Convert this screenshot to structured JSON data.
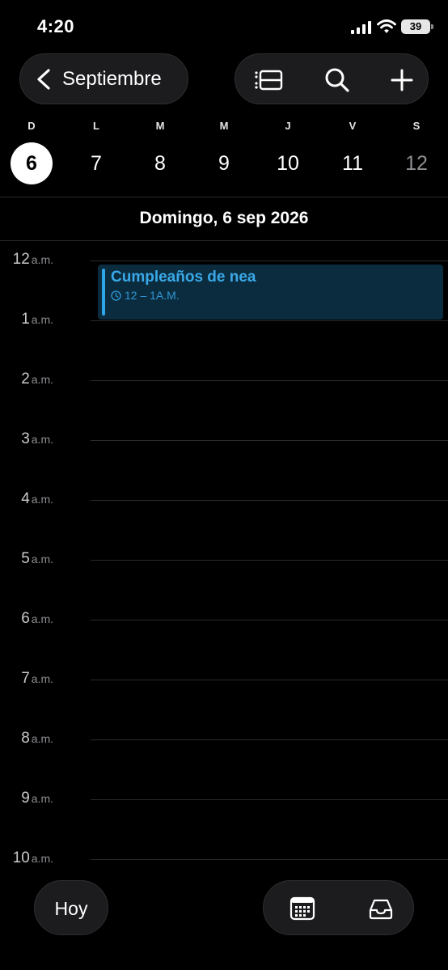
{
  "status_bar": {
    "time": "4:20",
    "battery": "39"
  },
  "nav": {
    "back_label": "Septiembre",
    "icons": [
      "list-view-icon",
      "search-icon",
      "plus-icon"
    ]
  },
  "week": {
    "days": [
      {
        "letter": "D",
        "num": "6",
        "selected": true
      },
      {
        "letter": "L",
        "num": "7"
      },
      {
        "letter": "M",
        "num": "8"
      },
      {
        "letter": "M",
        "num": "9"
      },
      {
        "letter": "J",
        "num": "10"
      },
      {
        "letter": "V",
        "num": "11"
      },
      {
        "letter": "S",
        "num": "12",
        "dim": true
      }
    ]
  },
  "date_title": "Domingo, 6 sep 2026",
  "hours": [
    {
      "num": "12",
      "ampm": "a.m."
    },
    {
      "num": "1",
      "ampm": "a.m."
    },
    {
      "num": "2",
      "ampm": "a.m."
    },
    {
      "num": "3",
      "ampm": "a.m."
    },
    {
      "num": "4",
      "ampm": "a.m."
    },
    {
      "num": "5",
      "ampm": "a.m."
    },
    {
      "num": "6",
      "ampm": "a.m."
    },
    {
      "num": "7",
      "ampm": "a.m."
    },
    {
      "num": "8",
      "ampm": "a.m."
    },
    {
      "num": "9",
      "ampm": "a.m."
    },
    {
      "num": "10",
      "ampm": "a.m."
    }
  ],
  "event": {
    "title": "Cumpleaños de nea",
    "time": "12 – 1A.M.",
    "color": "#2fa6e8"
  },
  "bottom": {
    "today_label": "Hoy",
    "icons": [
      "calendar-grid-icon",
      "inbox-icon"
    ]
  }
}
